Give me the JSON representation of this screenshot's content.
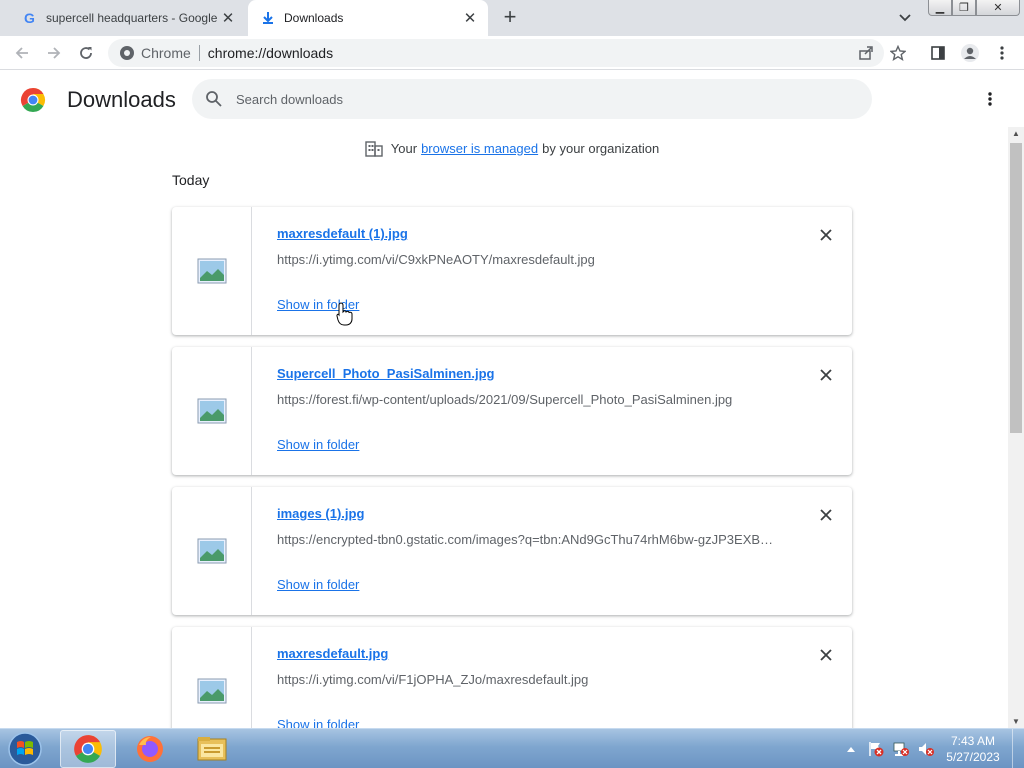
{
  "tabs": [
    {
      "title": "supercell headquarters - Google",
      "active": false
    },
    {
      "title": "Downloads",
      "active": true
    }
  ],
  "toolbar": {
    "site_label": "Chrome",
    "url": "chrome://downloads"
  },
  "header": {
    "title": "Downloads",
    "search_placeholder": "Search downloads"
  },
  "managed_notice": {
    "prefix": "Your",
    "link": "browser is managed",
    "suffix": "by your organization"
  },
  "date_header": "Today",
  "downloads": [
    {
      "filename": "maxresdefault (1).jpg",
      "url": "https://i.ytimg.com/vi/C9xkPNeAOTY/maxresdefault.jpg",
      "action": "Show in folder"
    },
    {
      "filename": "Supercell_Photo_PasiSalminen.jpg",
      "url": "https://forest.fi/wp-content/uploads/2021/09/Supercell_Photo_PasiSalminen.jpg",
      "action": "Show in folder"
    },
    {
      "filename": "images (1).jpg",
      "url": "https://encrypted-tbn0.gstatic.com/images?q=tbn:ANd9GcThu74rhM6bw-gzJP3EXB…",
      "action": "Show in folder"
    },
    {
      "filename": "maxresdefault.jpg",
      "url": "https://i.ytimg.com/vi/F1jOPHA_ZJo/maxresdefault.jpg",
      "action": "Show in folder"
    }
  ],
  "taskbar": {
    "apps": [
      "chrome-icon",
      "firefox-icon",
      "file-explorer-icon"
    ],
    "time": "7:43 AM",
    "date": "5/27/2023"
  },
  "colors": {
    "link": "#1a73e8",
    "tabstrip": "#dee1e6",
    "omnibox": "#f1f3f4"
  }
}
